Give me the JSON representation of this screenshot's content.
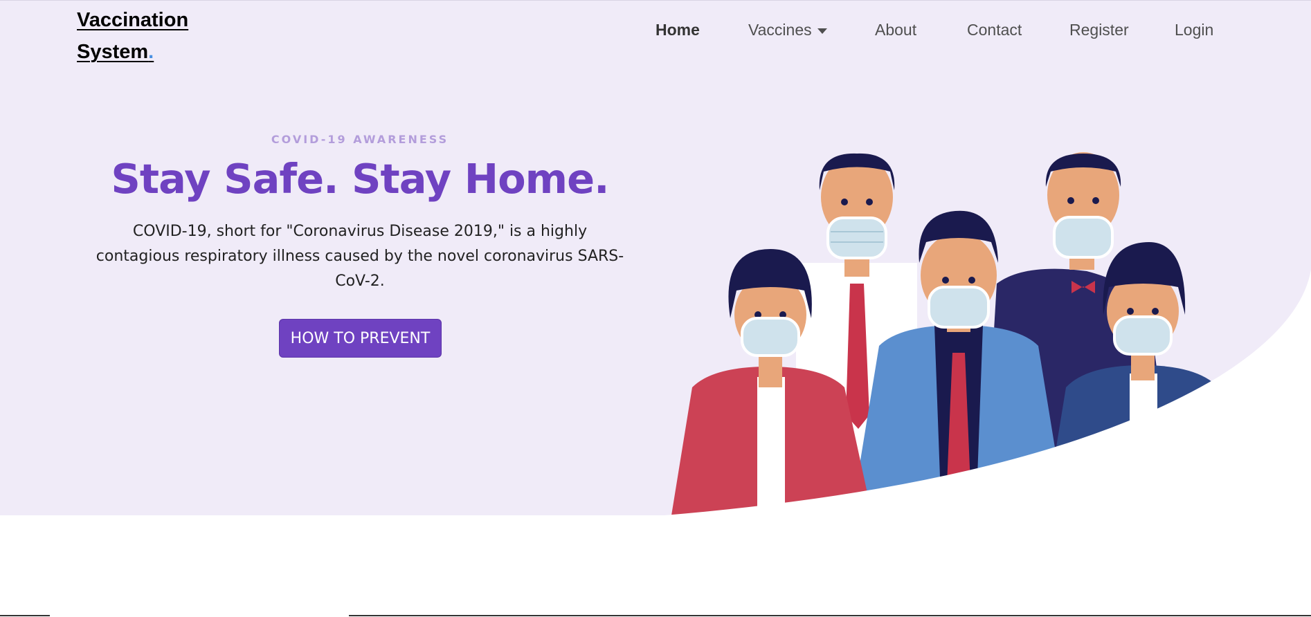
{
  "brand": {
    "line1": "Vaccination",
    "line2": "System",
    "dot": "."
  },
  "nav": {
    "items": [
      {
        "label": "Home"
      },
      {
        "label": "Vaccines"
      },
      {
        "label": "About"
      },
      {
        "label": "Contact"
      },
      {
        "label": "Register"
      },
      {
        "label": "Login"
      }
    ]
  },
  "hero": {
    "eyebrow": "COVID-19 AWARENESS",
    "headline": "Stay Safe. Stay Home.",
    "description": "COVID-19, short for \"Coronavirus Disease 2019,\" is a highly contagious respiratory illness caused by the novel coronavirus SARS-CoV-2.",
    "cta_label": "HOW TO PREVENT"
  },
  "colors": {
    "hero_background": "#f0ebf8",
    "accent": "#6f42c1",
    "eyebrow": "#b39ddb"
  },
  "illustration": {
    "subject": "people-wearing-face-masks"
  }
}
